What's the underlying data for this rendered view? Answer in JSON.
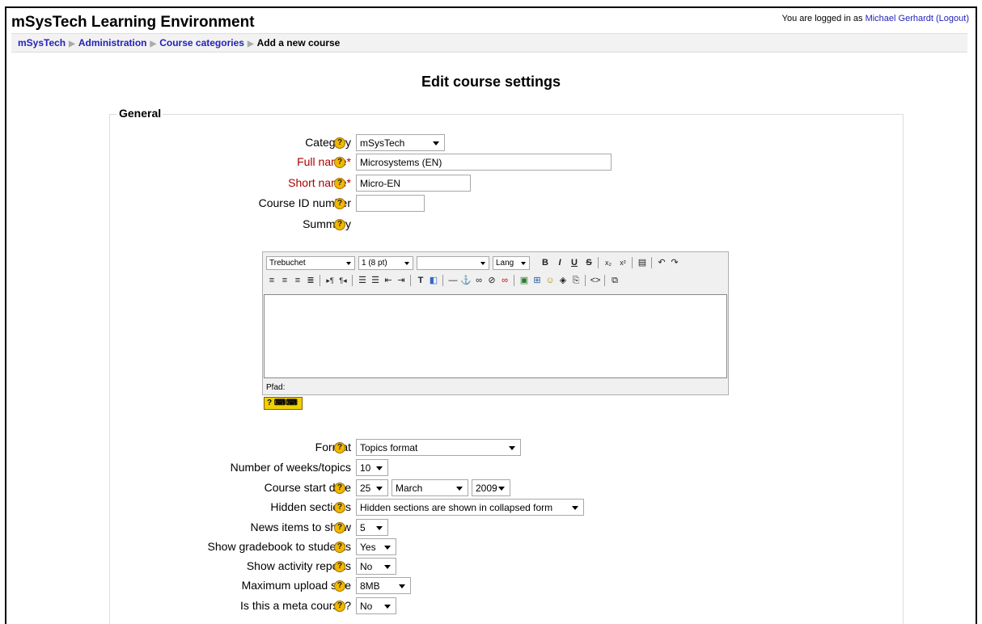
{
  "header": {
    "site_title": "mSysTech Learning Environment",
    "login_prefix": "You are logged in as ",
    "user_name": "Michael Gerhardt",
    "logout_label": "(Logout)"
  },
  "breadcrumb": [
    "mSysTech",
    "Administration",
    "Course categories",
    "Add a new course"
  ],
  "page_title": "Edit course settings",
  "section_title": "General",
  "form": {
    "category": {
      "label": "Category",
      "value": "mSysTech"
    },
    "fullname": {
      "label": "Full name*",
      "value": "Microsystems (EN)"
    },
    "shortname": {
      "label": "Short name*",
      "value": "Micro-EN"
    },
    "idnumber": {
      "label": "Course ID number",
      "value": ""
    },
    "summary": {
      "label": "Summary"
    },
    "format": {
      "label": "Format",
      "value": "Topics format"
    },
    "numsections": {
      "label": "Number of weeks/topics",
      "value": "10"
    },
    "startdate": {
      "label": "Course start date",
      "day": "25",
      "month": "March",
      "year": "2009"
    },
    "hiddensections": {
      "label": "Hidden sections",
      "value": "Hidden sections are shown in collapsed form"
    },
    "newsitems": {
      "label": "News items to show",
      "value": "5"
    },
    "showgrades": {
      "label": "Show gradebook to students",
      "value": "Yes"
    },
    "showreports": {
      "label": "Show activity reports",
      "value": "No"
    },
    "maxbytes": {
      "label": "Maximum upload size",
      "value": "8MB"
    },
    "metacourse": {
      "label": "Is this a meta course?",
      "value": "No"
    }
  },
  "editor": {
    "font": "Trebuchet",
    "size": "1 (8 pt)",
    "style": "",
    "lang": "Lang",
    "path_label": "Pfad:",
    "help_glyph": "?"
  }
}
